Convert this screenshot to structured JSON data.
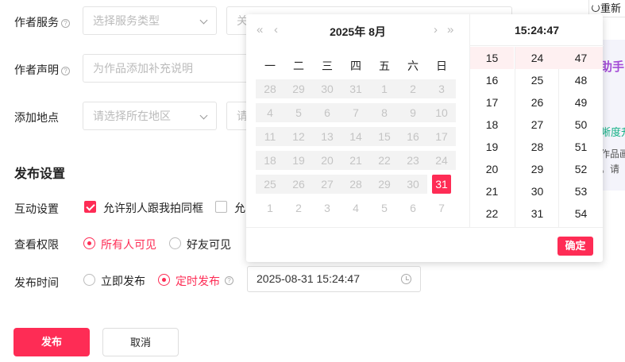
{
  "form": {
    "author_service": {
      "label": "作者服务",
      "placeholder": "选择服务类型",
      "placeholder2": "关"
    },
    "author_statement": {
      "label": "作者声明",
      "placeholder": "为作品添加补充说明"
    },
    "location": {
      "label": "添加地点",
      "placeholder": "请选择所在地区",
      "placeholder2": "请"
    }
  },
  "publish_settings": {
    "title": "发布设置",
    "interaction": {
      "label": "互动设置",
      "opt1": "允许别人跟我拍同框",
      "opt1_checked": true,
      "opt2": "允",
      "opt2_checked": false
    },
    "visibility": {
      "label": "查看权限",
      "opt1": "所有人可见",
      "opt2": "好友可见",
      "selected": "所有人可见"
    },
    "publish_time": {
      "label": "发布时间",
      "opt1": "立即发布",
      "opt2": "定时发布",
      "selected": "定时发布",
      "value": "2025-08-31 15:24:47"
    }
  },
  "buttons": {
    "publish": "发布",
    "cancel": "取消"
  },
  "side_panel": {
    "refresh": "重新",
    "s1": "助手",
    "s2": "晰度升",
    "s3": "作品画",
    "s4": "。请"
  },
  "picker": {
    "nav": {
      "prev_year": "«",
      "prev_month": "‹",
      "next_month": "›",
      "next_year": "»"
    },
    "title": "2025年  8月",
    "weekdays": [
      "一",
      "二",
      "三",
      "四",
      "五",
      "六",
      "日"
    ],
    "weeks": [
      [
        "28",
        "29",
        "30",
        "31",
        "1",
        "2",
        "3"
      ],
      [
        "4",
        "5",
        "6",
        "7",
        "8",
        "9",
        "10"
      ],
      [
        "11",
        "12",
        "13",
        "14",
        "15",
        "16",
        "17"
      ],
      [
        "18",
        "19",
        "20",
        "21",
        "22",
        "23",
        "24"
      ],
      [
        "25",
        "26",
        "27",
        "28",
        "29",
        "30",
        "31"
      ],
      [
        "1",
        "2",
        "3",
        "4",
        "5",
        "6",
        "7"
      ]
    ],
    "selected_day": "31",
    "time_title": "15:24:47",
    "hours": [
      "15",
      "16",
      "17",
      "18",
      "19",
      "20",
      "21",
      "22"
    ],
    "minutes": [
      "24",
      "25",
      "26",
      "27",
      "28",
      "29",
      "30",
      "31"
    ],
    "seconds": [
      "47",
      "48",
      "49",
      "50",
      "51",
      "52",
      "53",
      "54"
    ],
    "confirm": "确定"
  }
}
